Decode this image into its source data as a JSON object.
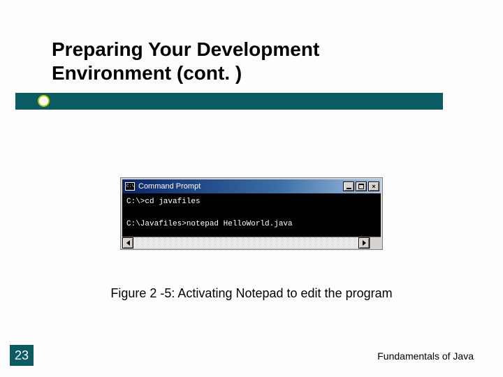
{
  "title": "Preparing Your Development Environment (cont. )",
  "window": {
    "title": "Command Prompt",
    "minimize_aria": "Minimize",
    "maximize_aria": "Maximize",
    "close_aria": "Close",
    "terminal_lines": [
      "C:\\>cd javafiles",
      "",
      "C:\\Javafiles>notepad HelloWorld.java"
    ]
  },
  "caption": "Figure 2 -5: Activating Notepad to edit the program",
  "page_number": "23",
  "footer": "Fundamentals of Java"
}
